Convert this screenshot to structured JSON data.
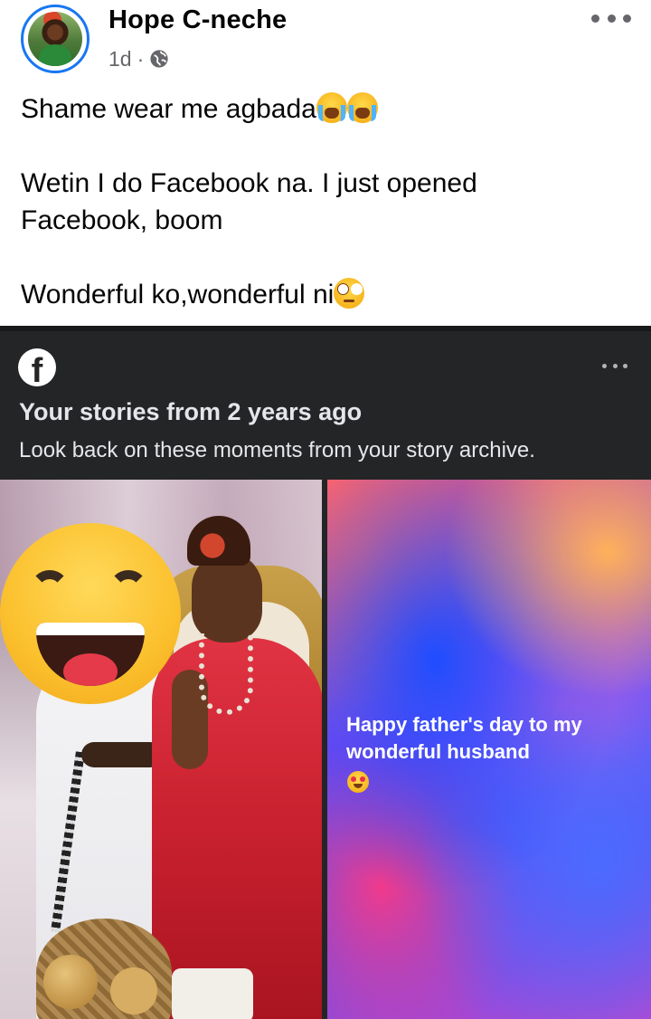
{
  "post": {
    "author": "Hope C-neche",
    "time": "1d",
    "separator": "·",
    "audience_icon": "globe-icon",
    "more_icon": "more-horizontal-icon",
    "lines": [
      "Shame wear me agbada",
      "Wetin I do Facebook na. I just opened",
      "Facebook, boom",
      "Wonderful ko,wonderful ni"
    ],
    "emojis": [
      "loudly-crying-face",
      "loudly-crying-face",
      "face-with-rolling-eyes"
    ]
  },
  "memory": {
    "logo": "f",
    "logo_icon": "facebook-logo-icon",
    "title": "Your stories from 2 years ago",
    "subtitle": "Look back on these moments from your story archive.",
    "stories": [
      {
        "kind": "photo",
        "overlay_emoji": "grinning-face-with-smiling-eyes"
      },
      {
        "kind": "text",
        "caption": "Happy father's day to my wonderful husband",
        "emoji": "smiling-face-with-heart-eyes"
      }
    ]
  },
  "colors": {
    "accent": "#1877f2",
    "card_bg": "#242526",
    "text_primary": "#050505",
    "text_secondary": "#65676b"
  }
}
